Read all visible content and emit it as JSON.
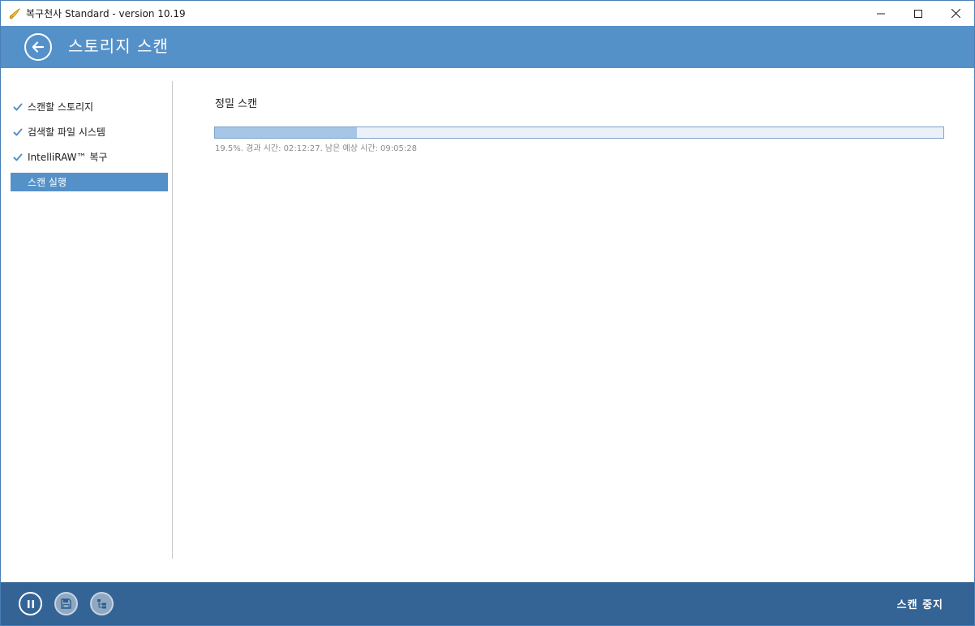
{
  "window": {
    "title": "복구천사 Standard - version 10.19",
    "icons": [
      "minimize-icon",
      "maximize-icon",
      "close-icon"
    ]
  },
  "header": {
    "title": "스토리지 스캔",
    "back_icon": "arrow-left-icon"
  },
  "sidebar": {
    "steps": [
      {
        "label": "스캔할 스토리지",
        "done": true
      },
      {
        "label": "검색할 파일 시스템",
        "done": true
      },
      {
        "label": "IntelliRAW™ 복구",
        "done": true
      },
      {
        "label": "스캔 실행",
        "done": false,
        "active": true
      }
    ]
  },
  "main": {
    "heading": "정밀 스캔",
    "progress_percent": 19.5,
    "progress_text": "19.5%. 경과 시간: 02:12:27. 남은 예상 시간: 09:05:28"
  },
  "footer": {
    "buttons": [
      "pause-icon",
      "save-icon",
      "tree-icon"
    ],
    "stop_label": "스캔 중지"
  },
  "colors": {
    "accent": "#5591c9",
    "footer": "#346496",
    "progress_fill": "#a6c6e7",
    "progress_track": "#ebf1f8"
  }
}
